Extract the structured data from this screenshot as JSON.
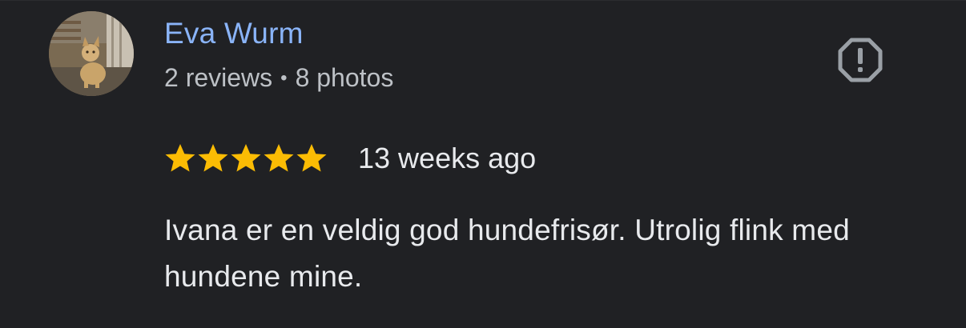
{
  "review": {
    "reviewer_name": "Eva Wurm",
    "reviews_count": "2 reviews",
    "separator": "•",
    "photos_count": "8 photos",
    "rating": 5,
    "rating_max": 5,
    "time": "13 weeks ago",
    "text": "Ivana er en veldig god hundefrisør. Utrolig flink med hundene mine."
  },
  "icons": {
    "report": "report-icon",
    "star": "star-icon",
    "avatar": "avatar-photo"
  },
  "colors": {
    "background": "#202124",
    "name": "#8ab4f8",
    "star": "#fbbc04",
    "text": "#e8eaed",
    "meta": "#bdc1c6",
    "report_icon": "#9aa0a6"
  }
}
